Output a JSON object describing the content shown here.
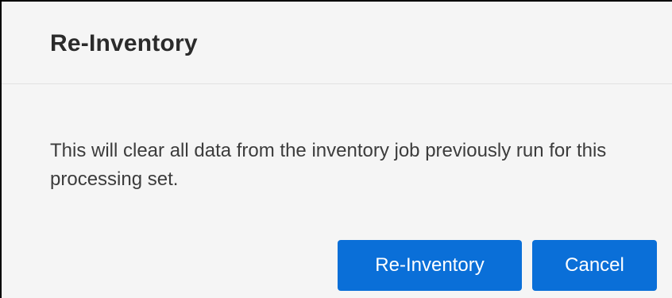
{
  "dialog": {
    "title": "Re-Inventory",
    "message": "This will clear all data from the inventory job previously run for this processing set.",
    "buttons": {
      "confirm_label": "Re-Inventory",
      "cancel_label": "Cancel"
    },
    "colors": {
      "button_bg": "#0a6fd8",
      "button_text": "#ffffff",
      "panel_bg": "#f5f5f5"
    }
  }
}
